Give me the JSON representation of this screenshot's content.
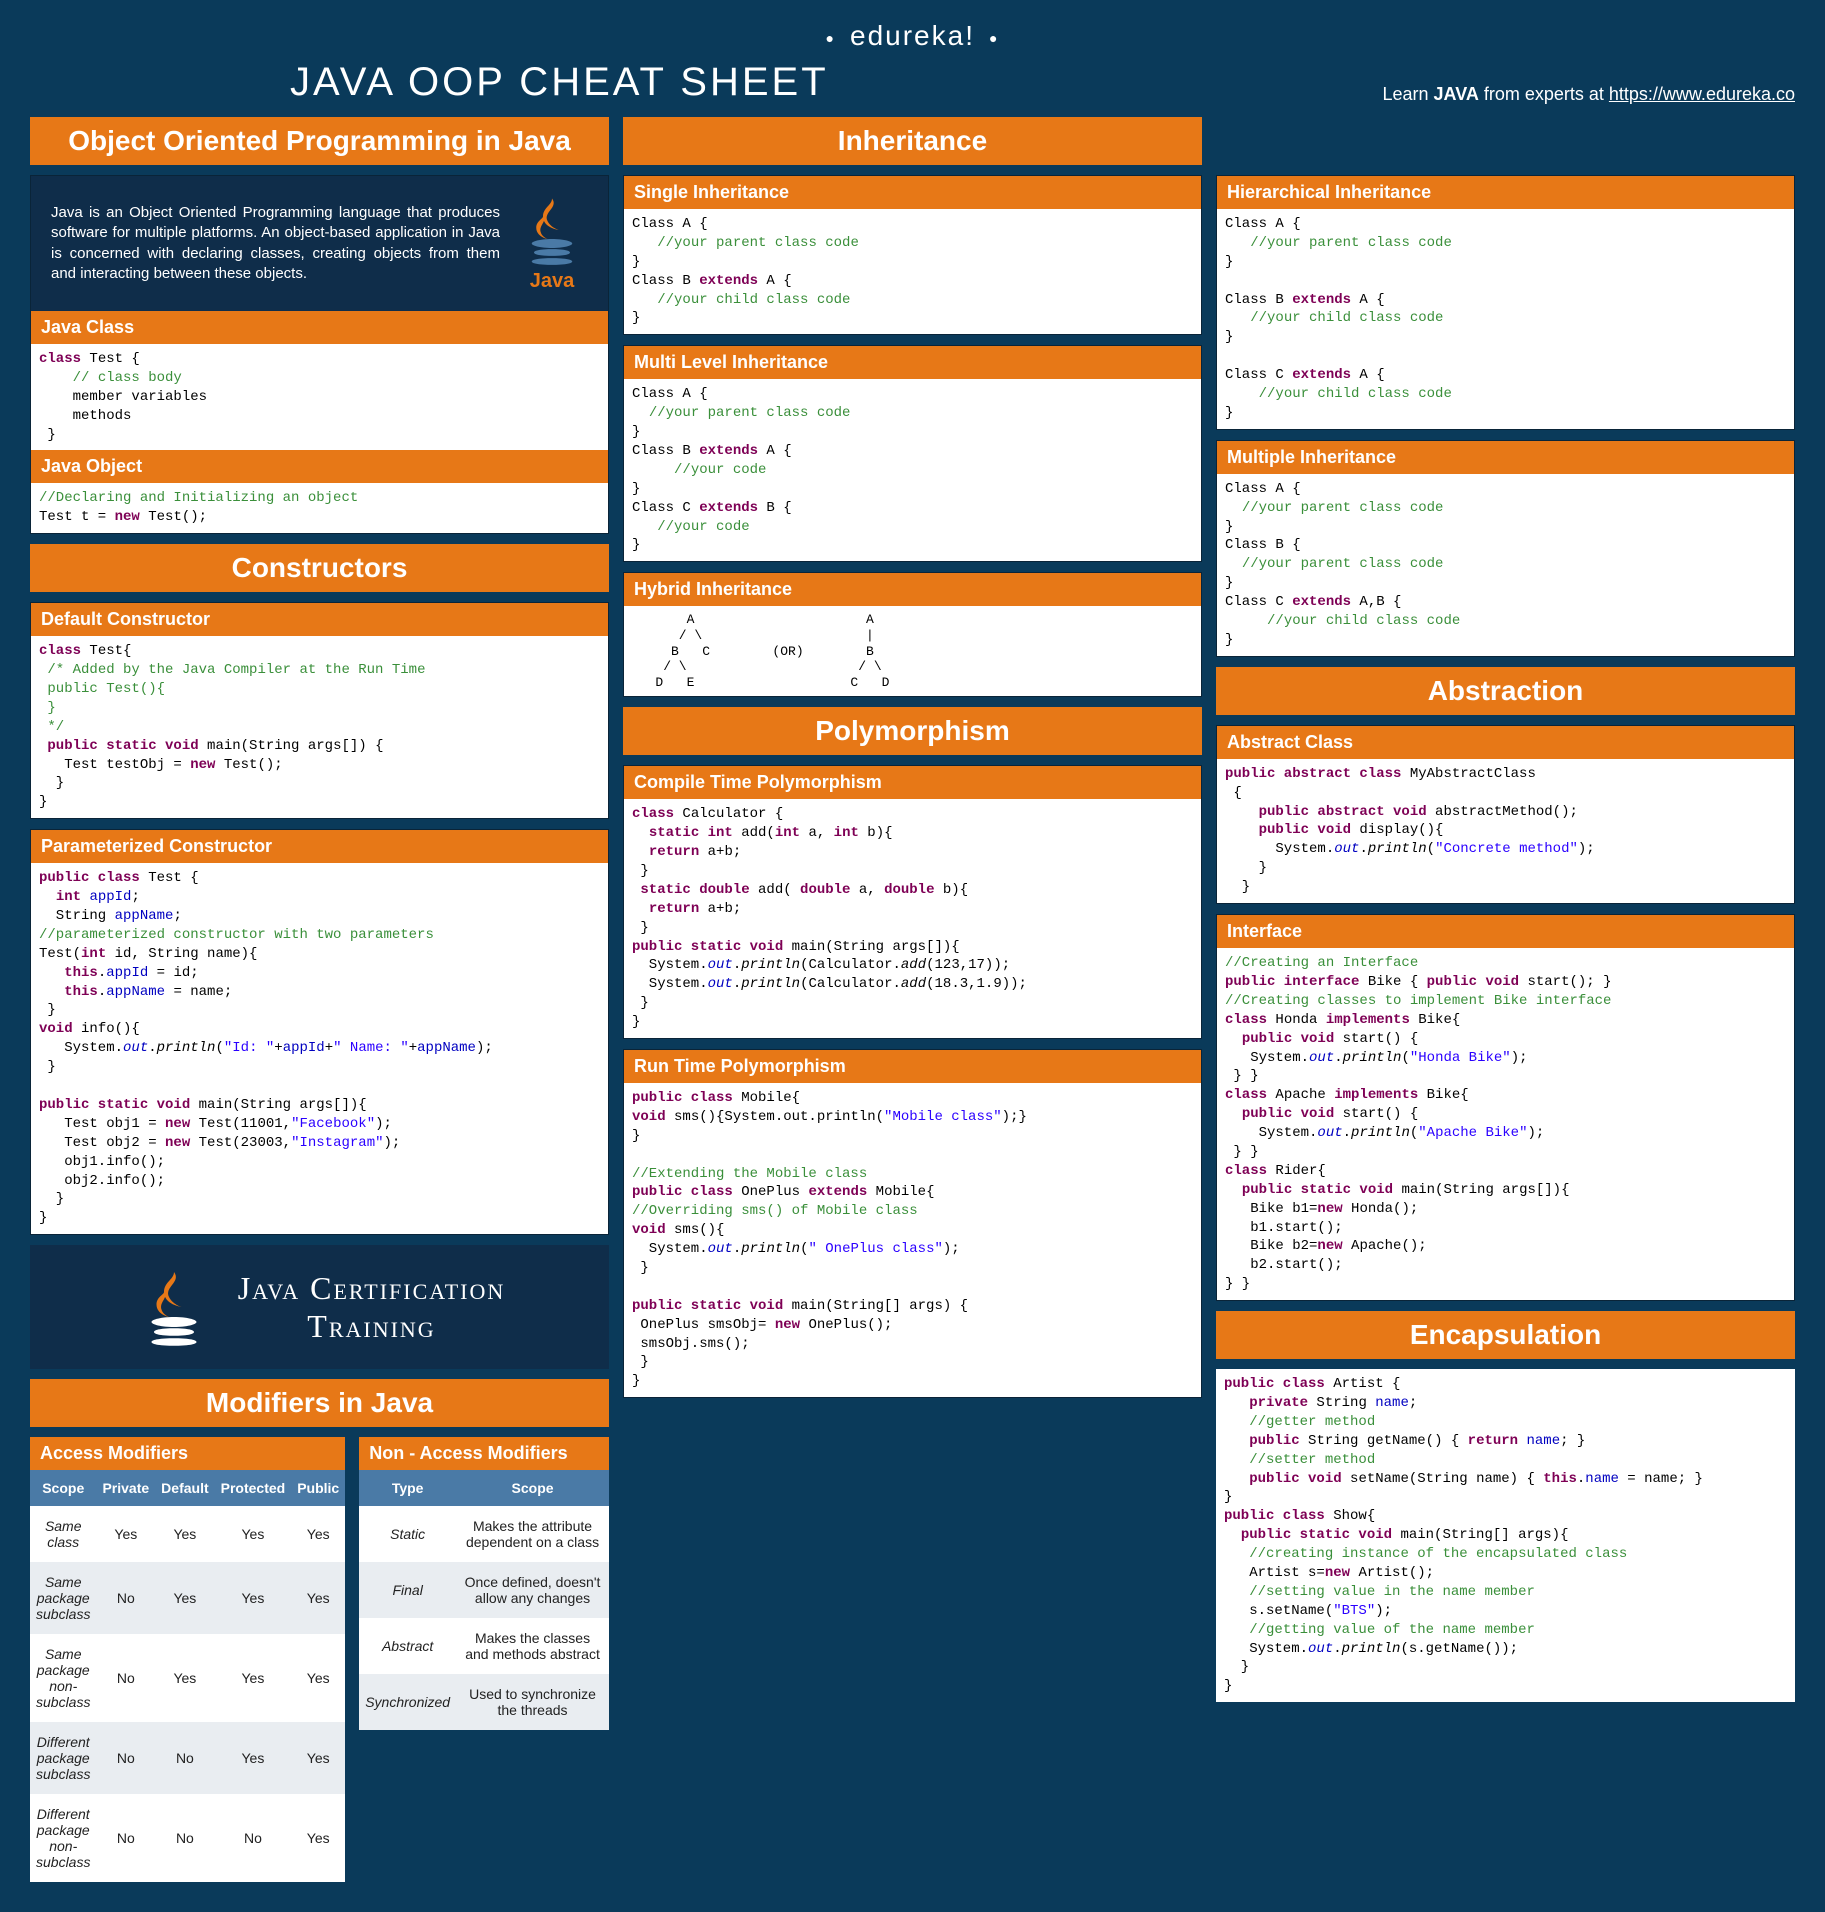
{
  "brand": "edureka!",
  "title": "JAVA OOP CHEAT SHEET",
  "learn_prefix": "Learn ",
  "learn_bold": "JAVA",
  "learn_suffix": " from experts at ",
  "learn_url": "https://www.edureka.co",
  "col1": {
    "sec_oop": "Object Oriented Programming in Java",
    "intro": "Java is an Object Oriented Programming language that produces software for multiple platforms. An object-based application in Java is concerned with declaring classes, creating objects from them and interacting between these objects.",
    "java_tag": "Java",
    "sub_class": "Java Class",
    "sub_object": "Java Object",
    "sec_ctor": "Constructors",
    "sub_defctor": "Default Constructor",
    "sub_paramctor": "Parameterized Constructor",
    "cert1": "Java Certification",
    "cert2": "Training",
    "sec_mod": "Modifiers in Java",
    "sub_access": "Access Modifiers",
    "sub_nonaccess": "Non - Access Modifiers"
  },
  "col2": {
    "sec_inh": "Inheritance",
    "sub_single": "Single Inheritance",
    "sub_multi": "Multi Level Inheritance",
    "sub_hybrid": "Hybrid Inheritance",
    "sec_poly": "Polymorphism",
    "sub_ctpoly": "Compile Time Polymorphism",
    "sub_rtpoly": "Run Time Polymorphism"
  },
  "col3": {
    "sub_hier": "Hierarchical Inheritance",
    "sub_mult": "Multiple Inheritance",
    "sec_abs": "Abstraction",
    "sub_absclass": "Abstract Class",
    "sub_iface": "Interface",
    "sec_enc": "Encapsulation"
  },
  "access_table": {
    "headers": [
      "Scope",
      "Private",
      "Default",
      "Protected",
      "Public"
    ],
    "rows": [
      [
        "Same class",
        "Yes",
        "Yes",
        "Yes",
        "Yes"
      ],
      [
        "Same package subclass",
        "No",
        "Yes",
        "Yes",
        "Yes"
      ],
      [
        "Same package non-subclass",
        "No",
        "Yes",
        "Yes",
        "Yes"
      ],
      [
        "Different package subclass",
        "No",
        "No",
        "Yes",
        "Yes"
      ],
      [
        "Different package non-subclass",
        "No",
        "No",
        "No",
        "Yes"
      ]
    ]
  },
  "nonaccess_table": {
    "headers": [
      "Type",
      "Scope"
    ],
    "rows": [
      [
        "Static",
        "Makes the attribute dependent on a class"
      ],
      [
        "Final",
        "Once defined, doesn't allow any changes"
      ],
      [
        "Abstract",
        "Makes the classes and methods abstract"
      ],
      [
        "Synchronized",
        "Used to synchronize the threads"
      ]
    ]
  },
  "hybrid_diagram": "       A                      A\n      / \\                     |\n     B   C        (OR)        B\n    / \\                      / \\\n   D   E                    C   D"
}
